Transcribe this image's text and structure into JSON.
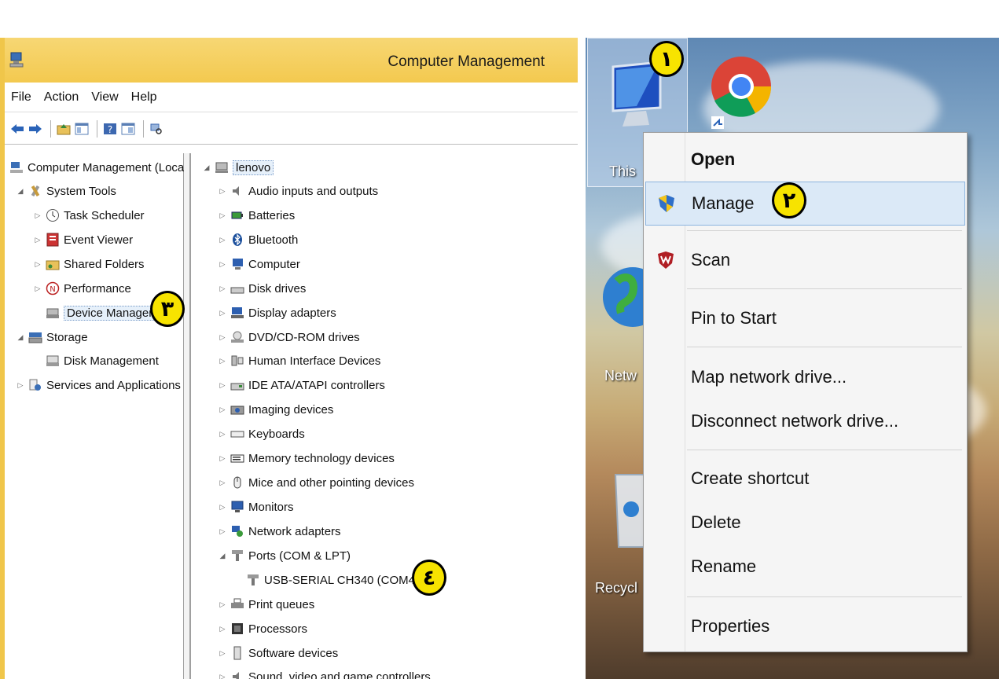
{
  "computer_management": {
    "title": "Computer Management",
    "menu": [
      "File",
      "Action",
      "View",
      "Help"
    ],
    "left_tree": {
      "root": "Computer Management (Local",
      "system_tools": "System Tools",
      "task_scheduler": "Task Scheduler",
      "event_viewer": "Event Viewer",
      "shared_folders": "Shared Folders",
      "performance": "Performance",
      "device_manager": "Device Manager",
      "storage": "Storage",
      "disk_management": "Disk Management",
      "services_apps": "Services and Applications"
    },
    "device_tree": {
      "root": "lenovo",
      "categories": [
        "Audio inputs and outputs",
        "Batteries",
        "Bluetooth",
        "Computer",
        "Disk drives",
        "Display adapters",
        "DVD/CD-ROM drives",
        "Human Interface Devices",
        "IDE ATA/ATAPI controllers",
        "Imaging devices",
        "Keyboards",
        "Memory technology devices",
        "Mice and other pointing devices",
        "Monitors",
        "Network adapters",
        "Ports (COM & LPT)",
        "USB-SERIAL CH340 (COM4)",
        "Print queues",
        "Processors",
        "Software devices",
        "Sound, video and game controllers"
      ]
    }
  },
  "desktop": {
    "icons": [
      "This",
      "Netw",
      "Recycl"
    ]
  },
  "context_menu": {
    "items": [
      "Open",
      "Manage",
      "Scan",
      "Pin to Start",
      "Map network drive...",
      "Disconnect network drive...",
      "Create shortcut",
      "Delete",
      "Rename",
      "Properties"
    ]
  },
  "badges": [
    "١",
    "٢",
    "٣",
    "٤"
  ],
  "colors": {
    "badge": "#f7e300",
    "titlebar": "#f3c94f",
    "highlight": "#dbe9f7"
  }
}
